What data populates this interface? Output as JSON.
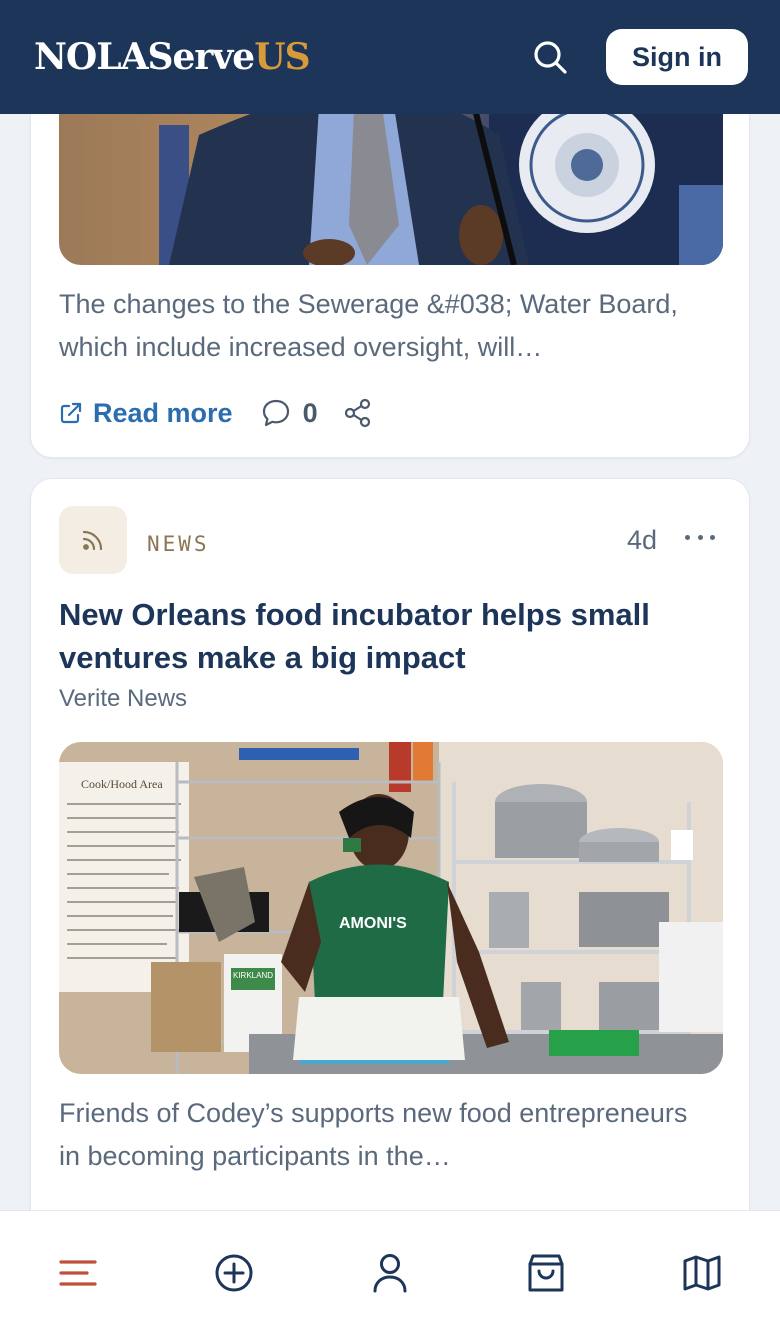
{
  "header": {
    "logo_main": "NOLAServe",
    "logo_accent": "US",
    "search_icon": "search-icon",
    "signin_label": "Sign in"
  },
  "colors": {
    "header_bg": "#1c3559",
    "logo_accent": "#d99a3a",
    "link": "#2c6db0",
    "nav_active": "#c0503a"
  },
  "feed": {
    "cards": [
      {
        "excerpt": "The changes to the Sewerage &#038; Water Board, which include increased oversight, will…",
        "actions": {
          "read_more_label": "Read more",
          "comment_count": "0"
        }
      },
      {
        "source_type": "NEWS",
        "age": "4d",
        "headline": "New Orleans food incubator helps small ventures make a big impact",
        "publisher": "Verite News",
        "excerpt": "Friends of Codey’s supports new food entrepreneurs in becoming participants in the…",
        "image_text": {
          "sign": "Cook/Hood Area",
          "shirt": "AMONI'S",
          "box": "KIRKLAND"
        }
      }
    ]
  },
  "bottom_nav": {
    "items": [
      "menu-icon",
      "add-icon",
      "profile-icon",
      "shopping-bag-icon",
      "map-icon"
    ]
  }
}
